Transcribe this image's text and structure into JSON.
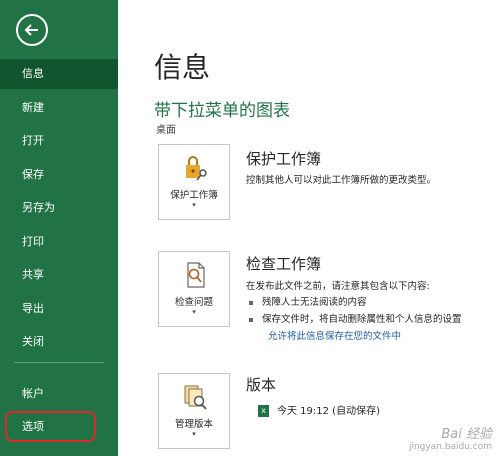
{
  "sidebar": {
    "items": [
      {
        "label": "信息",
        "active": true
      },
      {
        "label": "新建"
      },
      {
        "label": "打开"
      },
      {
        "label": "保存"
      },
      {
        "label": "另存为"
      },
      {
        "label": "打印"
      },
      {
        "label": "共享"
      },
      {
        "label": "导出"
      },
      {
        "label": "关闭"
      },
      {
        "label": "帐户"
      },
      {
        "label": "选项",
        "highlighted": true
      }
    ],
    "color": "#217346",
    "active_color": "#10552f",
    "highlight_color": "#e0262b"
  },
  "main": {
    "title": "信息",
    "doc_title": "带下拉菜单的图表",
    "doc_path": "桌面",
    "sections": {
      "protect": {
        "tile_label": "保护工作簿",
        "title": "保护工作簿",
        "desc": "控制其他人可以对此工作簿所做的更改类型。"
      },
      "inspect": {
        "tile_label": "检查问题",
        "title": "检查工作簿",
        "desc": "在发布此文件之前，请注意其包含以下内容:",
        "bullets": [
          "残障人士无法阅读的内容",
          "保存文件时，将自动删除属性和个人信息的设置"
        ],
        "link": "允许将此信息保存在您的文件中"
      },
      "versions": {
        "tile_label": "管理版本",
        "title": "版本",
        "entry": "今天 19:12 (自动保存)"
      }
    }
  },
  "watermark": {
    "main": "Bai 经验",
    "sub": "jingyan.baidu.com"
  }
}
